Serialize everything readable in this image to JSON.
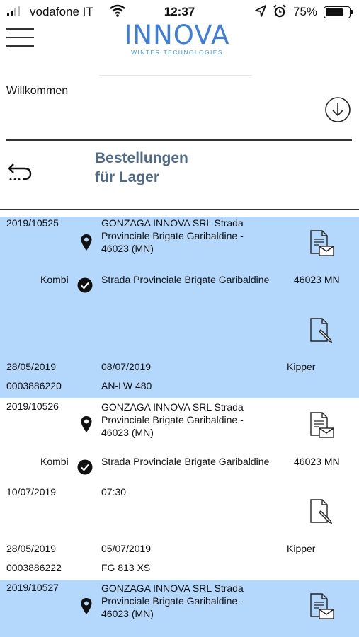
{
  "status_bar": {
    "carrier": "vodafone IT",
    "time": "12:37",
    "battery": "75%",
    "battery_level": 0.75
  },
  "header": {
    "logo_text": "INNOVA",
    "logo_subtext": "WINTER TECHNOLOGIES",
    "welcome": "Willkommen"
  },
  "page": {
    "title_line1": "Bestellungen",
    "title_line2": "für Lager"
  },
  "orders": [
    {
      "number": "2019/10525",
      "address_line1": "GONZAGA INNOVA SRL Strada",
      "address_line2": "Provinciale Brigate Garibaldine  -",
      "address_line3": "46023 (MN)",
      "type": "Kombi",
      "street": "Strada Provinciale Brigate Garibaldine",
      "zip": "46023 MN",
      "extra_date": "",
      "extra_time": "",
      "date1": "28/05/2019",
      "date2": "08/07/2019",
      "vehicle": "Kipper",
      "code": "0003886220",
      "plate": "AN-LW 480"
    },
    {
      "number": "2019/10526",
      "address_line1": "GONZAGA INNOVA SRL Strada",
      "address_line2": "Provinciale Brigate Garibaldine  -",
      "address_line3": "46023 (MN)",
      "type": "Kombi",
      "street": "Strada Provinciale Brigate Garibaldine",
      "zip": "46023 MN",
      "extra_date": "10/07/2019",
      "extra_time": "07:30",
      "date1": "28/05/2019",
      "date2": "05/07/2019",
      "vehicle": "Kipper",
      "code": "0003886222",
      "plate": "FG 813 XS"
    },
    {
      "number": "2019/10527",
      "address_line1": "GONZAGA INNOVA SRL Strada",
      "address_line2": "Provinciale Brigate Garibaldine  -",
      "address_line3": "46023 (MN)"
    }
  ],
  "colors": {
    "row_highlight": "#b3d8fb",
    "title": "#4f6a86",
    "logo": "#3d7fd8"
  },
  "icons": [
    "menu-icon",
    "download-icon",
    "back-icon",
    "location-pin-icon",
    "check-circle-icon",
    "document-mail-icon",
    "document-edit-icon"
  ]
}
